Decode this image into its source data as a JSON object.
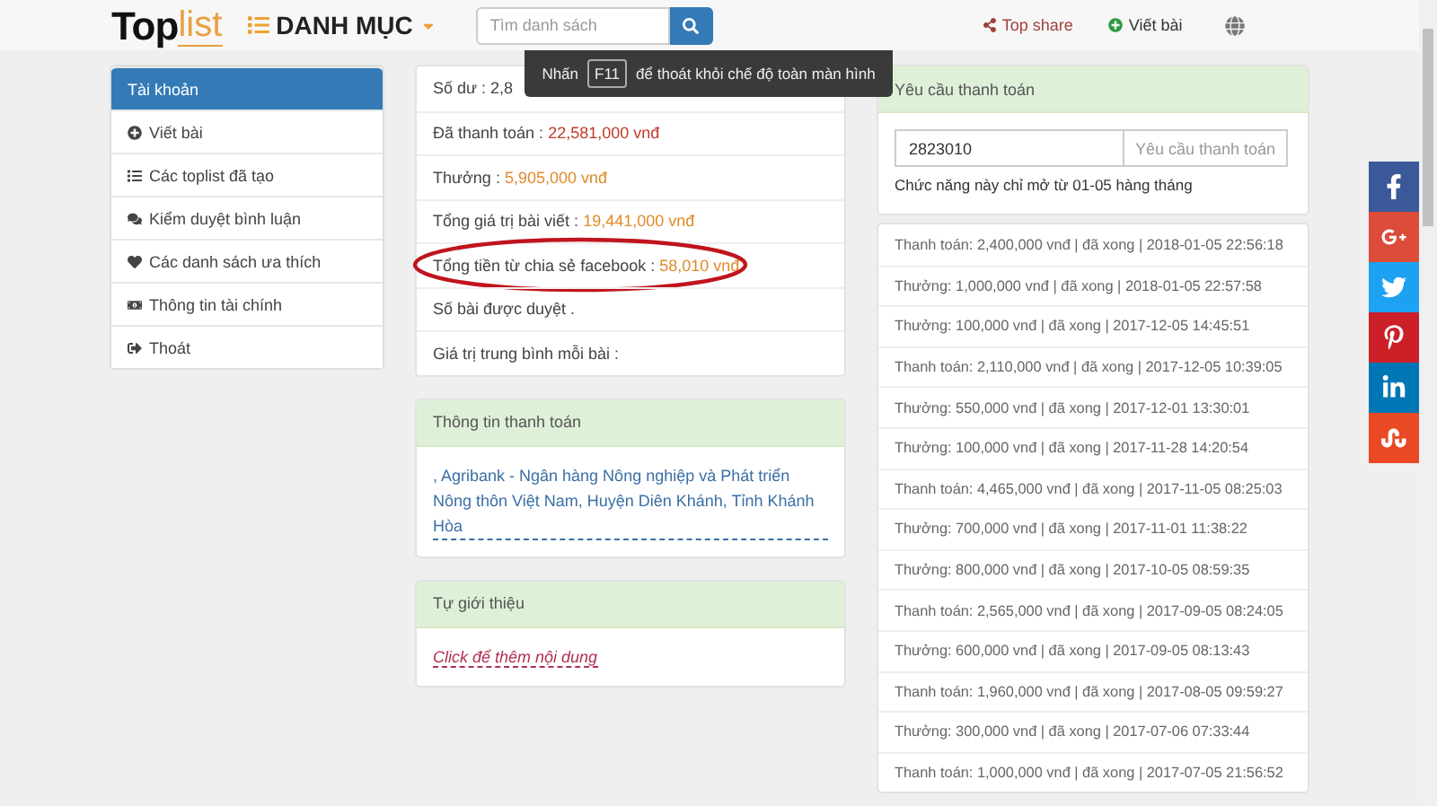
{
  "header": {
    "logo": {
      "part_1": "Top",
      "part_2": "list"
    },
    "menu_label": "DANH MỤC",
    "search": {
      "placeholder": "Tìm danh sách"
    },
    "links": [
      "Top share",
      "Viết bài"
    ]
  },
  "fullscreen_notice": {
    "before": "Nhấn",
    "key": "F11",
    "after": "để thoát khỏi chế độ toàn màn hình"
  },
  "sidebar": {
    "items": [
      {
        "label": "Tài khoản",
        "selected": true
      },
      {
        "label": "Viết bài",
        "selected": false
      },
      {
        "label": "Các toplist đã tạo",
        "selected": false
      },
      {
        "label": "Kiểm duyệt bình luận",
        "selected": false
      },
      {
        "label": "Các danh sách ưa thích",
        "selected": false
      },
      {
        "label": "Thông tin tài chính",
        "selected": false
      },
      {
        "label": "Thoát",
        "selected": false
      }
    ]
  },
  "stats": [
    {
      "label": "Số dư : 2,8",
      "highlighted": false
    },
    {
      "label": "Đã thanh toán :",
      "value": "22,581,000 vnđ",
      "color": "#c0392b",
      "highlighted": false
    },
    {
      "label": "Thưởng :",
      "value": "5,905,000 vnđ",
      "color": "#e08a2a",
      "highlighted": false
    },
    {
      "label": "Tổng giá trị bài viết :",
      "value": "19,441,000 vnđ",
      "color": "#e08a2a",
      "highlighted": false
    },
    {
      "label": "Tổng tiền từ chia sẻ facebook :",
      "value": "58,010 vnđ",
      "color": "#e08a2a",
      "highlighted": true
    },
    {
      "label": "Số bài được duyệt .",
      "highlighted": false
    },
    {
      "label": "Giá trị trung bình mỗi bài :",
      "highlighted": false
    }
  ],
  "payment_info": {
    "title": "Thông tin thanh toán",
    "text": ", Agribank - Ngân hàng Nông nghiệp và Phát triển Nông thôn Việt Nam, Huyện Diên Khánh, Tỉnh Khánh Hòa"
  },
  "self_intro": {
    "title": "Tự giới thiệu",
    "link": "Click để thêm nội dung"
  },
  "payment_request": {
    "title": "Yêu cầu thanh toán",
    "amount": "2823010",
    "button": "Yêu cầu thanh toán",
    "note": "Chức năng này chỉ mở từ 01-05 hàng tháng"
  },
  "transactions": [
    "Thanh toán: 2,400,000 vnđ | đã xong | 2018-01-05 22:56:18",
    "Thưởng: 1,000,000 vnđ | đã xong | 2018-01-05 22:57:58",
    "Thưởng: 100,000 vnđ | đã xong | 2017-12-05 14:45:51",
    "Thanh toán: 2,110,000 vnđ | đã xong | 2017-12-05 10:39:05",
    "Thưởng: 550,000 vnđ | đã xong | 2017-12-01 13:30:01",
    "Thưởng: 100,000 vnđ | đã xong | 2017-11-28 14:20:54",
    "Thanh toán: 4,465,000 vnđ | đã xong | 2017-11-05 08:25:03",
    "Thưởng: 700,000 vnđ | đã xong | 2017-11-01 11:38:22",
    "Thưởng: 800,000 vnđ | đã xong | 2017-10-05 08:59:35",
    "Thanh toán: 2,565,000 vnđ | đã xong | 2017-09-05 08:24:05",
    "Thưởng: 600,000 vnđ | đã xong | 2017-09-05 08:13:43",
    "Thanh toán: 1,960,000 vnđ | đã xong | 2017-08-05 09:59:27",
    "Thưởng: 300,000 vnđ | đã xong | 2017-07-06 07:33:44",
    "Thanh toán: 1,000,000 vnđ | đã xong | 2017-07-05 21:56:52"
  ]
}
